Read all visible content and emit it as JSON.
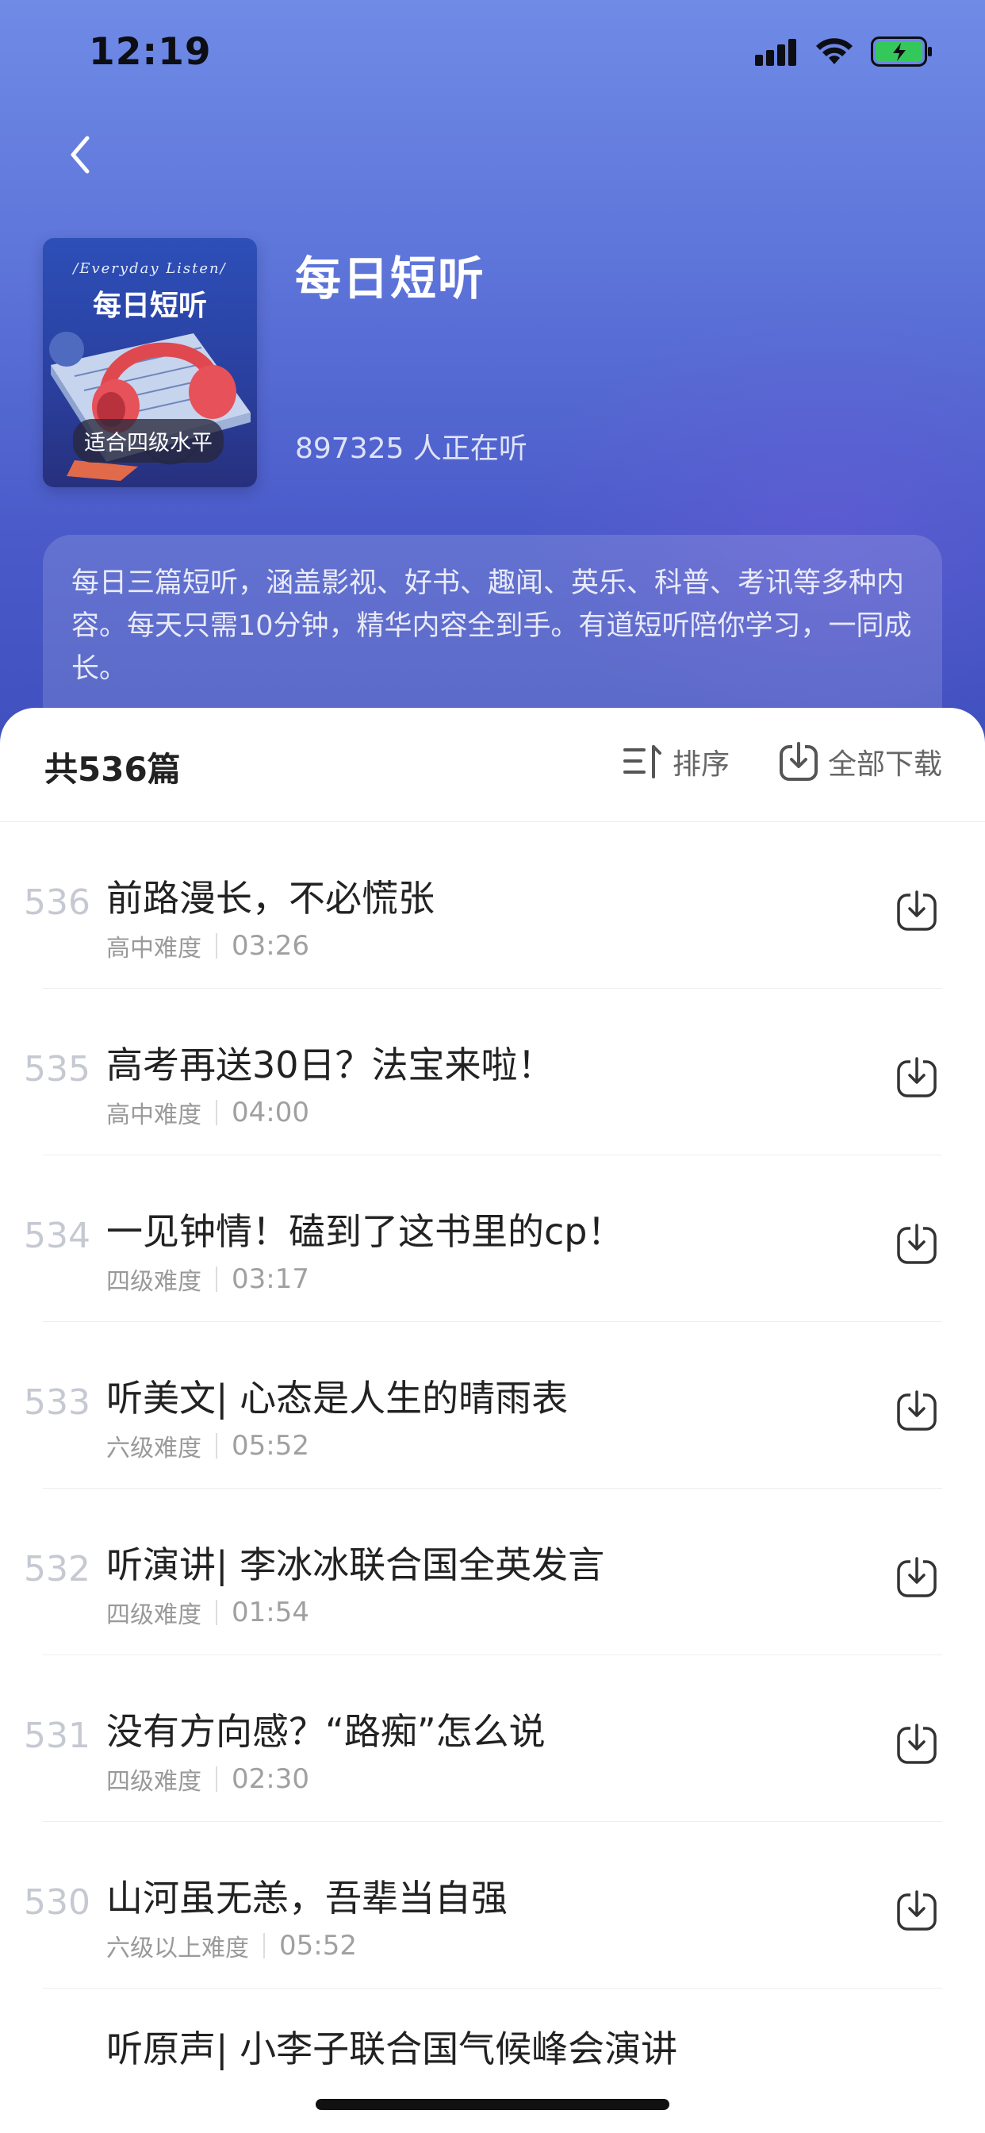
{
  "status_bar": {
    "time": "12:19"
  },
  "album": {
    "cover_subtitle": "/Everyday Listen/",
    "cover_title": "每日短听",
    "cover_badge": "适合四级水平",
    "title": "每日短听",
    "listeners": "897325 人正在听",
    "description": "每日三篇短听，涵盖影视、好书、趣闻、英乐、科普、考讯等多种内容。每天只需10分钟，精华内容全到手。有道短听陪你学习，一同成长。"
  },
  "toolbar": {
    "count": "共536篇",
    "sort_label": "排序",
    "download_all_label": "全部下载"
  },
  "episodes": [
    {
      "num": "536",
      "title": "前路漫长，不必慌张",
      "level": "高中难度",
      "duration": "03:26"
    },
    {
      "num": "535",
      "title": "高考再送30日？法宝来啦！",
      "level": "高中难度",
      "duration": "04:00"
    },
    {
      "num": "534",
      "title": "一见钟情！磕到了这书里的cp！",
      "level": "四级难度",
      "duration": "03:17"
    },
    {
      "num": "533",
      "title": "听美文| 心态是人生的晴雨表",
      "level": "六级难度",
      "duration": "05:52"
    },
    {
      "num": "532",
      "title": "听演讲| 李冰冰联合国全英发言",
      "level": "四级难度",
      "duration": "01:54"
    },
    {
      "num": "531",
      "title": "没有方向感？“路痴”怎么说",
      "level": "四级难度",
      "duration": "02:30"
    },
    {
      "num": "530",
      "title": "山河虽无恙，吾辈当自强",
      "level": "六级以上难度",
      "duration": "05:52"
    },
    {
      "num": "",
      "title": "听原声| 小李子联合国气候峰会演讲",
      "level": "",
      "duration": ""
    }
  ],
  "colors": {
    "header_top": "#6f8be6",
    "header_bottom": "#3f4fbd",
    "text_primary": "#222222",
    "text_muted": "#9a9a9a"
  },
  "icons": {
    "back": "chevron-left-icon",
    "sort": "sort-icon",
    "download": "download-icon",
    "signal": "cellular-signal-icon",
    "wifi": "wifi-icon",
    "battery": "battery-charging-icon"
  }
}
